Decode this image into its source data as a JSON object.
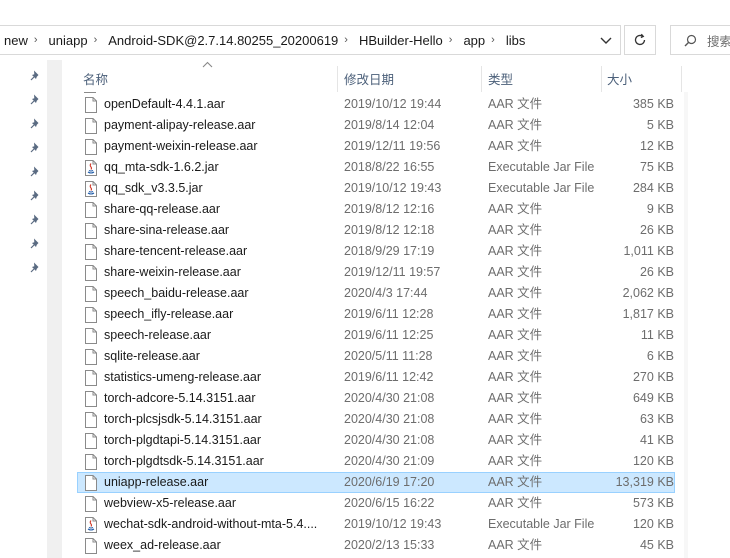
{
  "breadcrumb": {
    "items": [
      "new",
      "uniapp",
      "Android-SDK@2.7.14.80255_20200619",
      "HBuilder-Hello",
      "app",
      "libs"
    ]
  },
  "search": {
    "placeholder": "搜索"
  },
  "columns": {
    "name": "名称",
    "date": "修改日期",
    "type": "类型",
    "size": "大小"
  },
  "colors": {
    "selected_bg": "#cce8ff",
    "selected_border": "#99d1ff",
    "header_text": "#4c607a",
    "muted_text": "#6d6d6d"
  },
  "files": [
    {
      "name": "openDefault-4.4.1.aar",
      "date": "2019/10/12 19:44",
      "type": "AAR 文件",
      "size": "385 KB",
      "icon": "file-icon"
    },
    {
      "name": "payment-alipay-release.aar",
      "date": "2019/8/14 12:04",
      "type": "AAR 文件",
      "size": "5 KB",
      "icon": "file-icon"
    },
    {
      "name": "payment-weixin-release.aar",
      "date": "2019/12/11 19:56",
      "type": "AAR 文件",
      "size": "12 KB",
      "icon": "file-icon"
    },
    {
      "name": "qq_mta-sdk-1.6.2.jar",
      "date": "2018/8/22 16:55",
      "type": "Executable Jar File",
      "size": "75 KB",
      "icon": "jar-icon"
    },
    {
      "name": "qq_sdk_v3.3.5.jar",
      "date": "2019/10/12 19:43",
      "type": "Executable Jar File",
      "size": "284 KB",
      "icon": "jar-icon"
    },
    {
      "name": "share-qq-release.aar",
      "date": "2019/8/12 12:16",
      "type": "AAR 文件",
      "size": "9 KB",
      "icon": "file-icon"
    },
    {
      "name": "share-sina-release.aar",
      "date": "2019/8/12 12:18",
      "type": "AAR 文件",
      "size": "26 KB",
      "icon": "file-icon"
    },
    {
      "name": "share-tencent-release.aar",
      "date": "2018/9/29 17:19",
      "type": "AAR 文件",
      "size": "1,011 KB",
      "icon": "file-icon"
    },
    {
      "name": "share-weixin-release.aar",
      "date": "2019/12/11 19:57",
      "type": "AAR 文件",
      "size": "26 KB",
      "icon": "file-icon"
    },
    {
      "name": "speech_baidu-release.aar",
      "date": "2020/4/3 17:44",
      "type": "AAR 文件",
      "size": "2,062 KB",
      "icon": "file-icon"
    },
    {
      "name": "speech_ifly-release.aar",
      "date": "2019/6/11 12:28",
      "type": "AAR 文件",
      "size": "1,817 KB",
      "icon": "file-icon"
    },
    {
      "name": "speech-release.aar",
      "date": "2019/6/11 12:25",
      "type": "AAR 文件",
      "size": "11 KB",
      "icon": "file-icon"
    },
    {
      "name": "sqlite-release.aar",
      "date": "2020/5/11 11:28",
      "type": "AAR 文件",
      "size": "6 KB",
      "icon": "file-icon"
    },
    {
      "name": "statistics-umeng-release.aar",
      "date": "2019/6/11 12:42",
      "type": "AAR 文件",
      "size": "270 KB",
      "icon": "file-icon"
    },
    {
      "name": "torch-adcore-5.14.3151.aar",
      "date": "2020/4/30 21:08",
      "type": "AAR 文件",
      "size": "649 KB",
      "icon": "file-icon"
    },
    {
      "name": "torch-plcsjsdk-5.14.3151.aar",
      "date": "2020/4/30 21:08",
      "type": "AAR 文件",
      "size": "63 KB",
      "icon": "file-icon"
    },
    {
      "name": "torch-plgdtapi-5.14.3151.aar",
      "date": "2020/4/30 21:08",
      "type": "AAR 文件",
      "size": "41 KB",
      "icon": "file-icon"
    },
    {
      "name": "torch-plgdtsdk-5.14.3151.aar",
      "date": "2020/4/30 21:09",
      "type": "AAR 文件",
      "size": "120 KB",
      "icon": "file-icon"
    },
    {
      "name": "uniapp-release.aar",
      "date": "2020/6/19 17:20",
      "type": "AAR 文件",
      "size": "13,319 KB",
      "icon": "file-icon",
      "selected": true
    },
    {
      "name": "webview-x5-release.aar",
      "date": "2020/6/15 16:22",
      "type": "AAR 文件",
      "size": "573 KB",
      "icon": "file-icon"
    },
    {
      "name": "wechat-sdk-android-without-mta-5.4....",
      "date": "2019/10/12 19:43",
      "type": "Executable Jar File",
      "size": "120 KB",
      "icon": "jar-icon"
    },
    {
      "name": "weex_ad-release.aar",
      "date": "2020/2/13 15:33",
      "type": "AAR 文件",
      "size": "45 KB",
      "icon": "file-icon"
    }
  ]
}
